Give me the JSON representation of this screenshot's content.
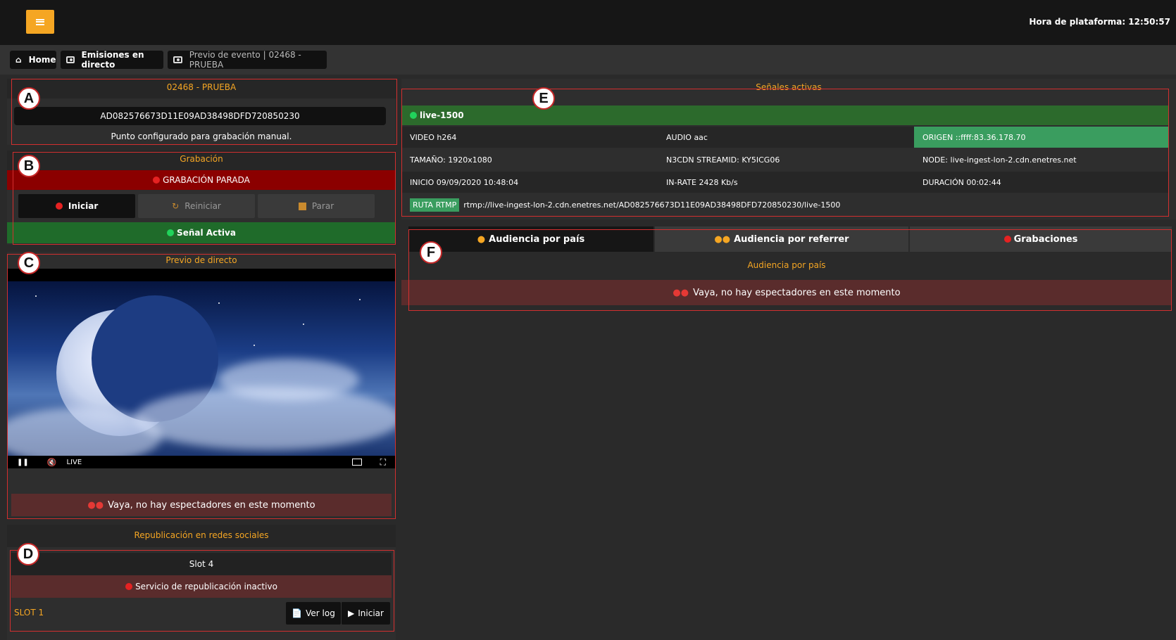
{
  "header": {
    "clock": "Hora de plataforma: 12:50:57"
  },
  "breadcrumb": [
    {
      "label": "Home",
      "icon": "home-icon"
    },
    {
      "label": "Emisiones en directo",
      "icon": "camera-icon"
    },
    {
      "label": "Previo de evento | 02468 - PRUEBA",
      "icon": "camera-icon"
    }
  ],
  "annotations": {
    "A": "A",
    "B": "B",
    "C": "C",
    "D": "D",
    "E": "E",
    "F": "F"
  },
  "event": {
    "title": "02468 - PRUEBA",
    "stream_key": "AD082576673D11E09AD38498DFD720850230",
    "note": "Punto configurado para grabación manual."
  },
  "recording": {
    "title": "Grabación",
    "status": "GRABACIÓN PARADA",
    "start": "Iniciar",
    "restart": "Reiniciar",
    "stop": "Parar",
    "signal": "Señal Activa"
  },
  "preview": {
    "title": "Previo de directo",
    "live": "LIVE",
    "no_viewers": "Vaya, no hay espectadores en este momento"
  },
  "social": {
    "title": "Republicación en redes sociales",
    "slot_header": "Slot 4",
    "status": "Servicio de republicación inactivo",
    "slot_label": "SLOT 1",
    "log_button": "Ver log",
    "start_button": "Iniciar"
  },
  "signals": {
    "title": "Señales activas",
    "name": "live-1500",
    "video": "VIDEO h264",
    "audio": "AUDIO aac",
    "origin": "ORIGEN ::ffff:83.36.178.70",
    "size": "TAMAÑO: 1920x1080",
    "streamid": "N3CDN STREAMID: KY5ICG06",
    "node": "NODE: live-ingest-lon-2.cdn.enetres.net",
    "start": "INICIO 09/09/2020 10:48:04",
    "inrate": "IN-RATE 2428 Kb/s",
    "duration": "DURACIÓN 00:02:44",
    "rtmp_label": "RUTA RTMP",
    "rtmp_url": "rtmp://live-ingest-lon-2.cdn.enetres.net/AD082576673D11E09AD38498DFD720850230/live-1500"
  },
  "audience": {
    "tabs": [
      "Audiencia por país",
      "Audiencia por referrer",
      "Grabaciones"
    ],
    "subtitle": "Audiencia por país",
    "no_viewers": "Vaya, no hay espectadores en este momento"
  },
  "colors": {
    "accent": "#f5a623",
    "red": "#8b0000",
    "green": "#1f6b2a",
    "origin": "#3a9d5f"
  }
}
